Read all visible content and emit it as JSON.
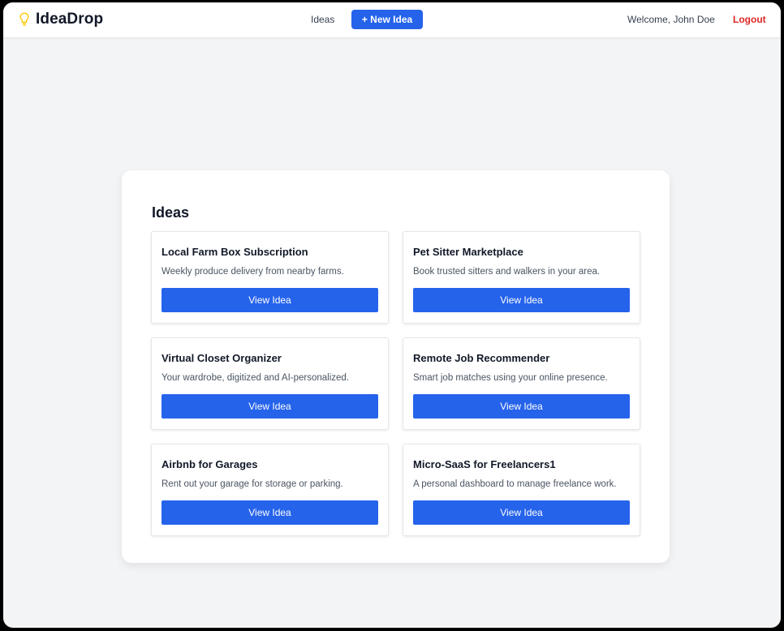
{
  "app": {
    "brand": "IdeaDrop",
    "brand_icon": "lightbulb-icon",
    "accent_color": "#2563eb",
    "logout_color": "#dc2626",
    "icon_color": "#facc15"
  },
  "nav": {
    "ideas_link": "Ideas",
    "new_idea_button": "+ New Idea",
    "welcome_text": "Welcome, John Doe",
    "logout_link": "Logout"
  },
  "main": {
    "title": "Ideas",
    "ideas": [
      {
        "title": "Local Farm Box Subscription",
        "description": "Weekly produce delivery from nearby farms.",
        "button": "View Idea"
      },
      {
        "title": "Pet Sitter Marketplace",
        "description": "Book trusted sitters and walkers in your area.",
        "button": "View Idea"
      },
      {
        "title": "Virtual Closet Organizer",
        "description": "Your wardrobe, digitized and AI-personalized.",
        "button": "View Idea"
      },
      {
        "title": "Remote Job Recommender",
        "description": "Smart job matches using your online presence.",
        "button": "View Idea"
      },
      {
        "title": "Airbnb for Garages",
        "description": "Rent out your garage for storage or parking.",
        "button": "View Idea"
      },
      {
        "title": "Micro-SaaS for Freelancers1",
        "description": "A personal dashboard to manage freelance work.",
        "button": "View Idea"
      }
    ]
  }
}
